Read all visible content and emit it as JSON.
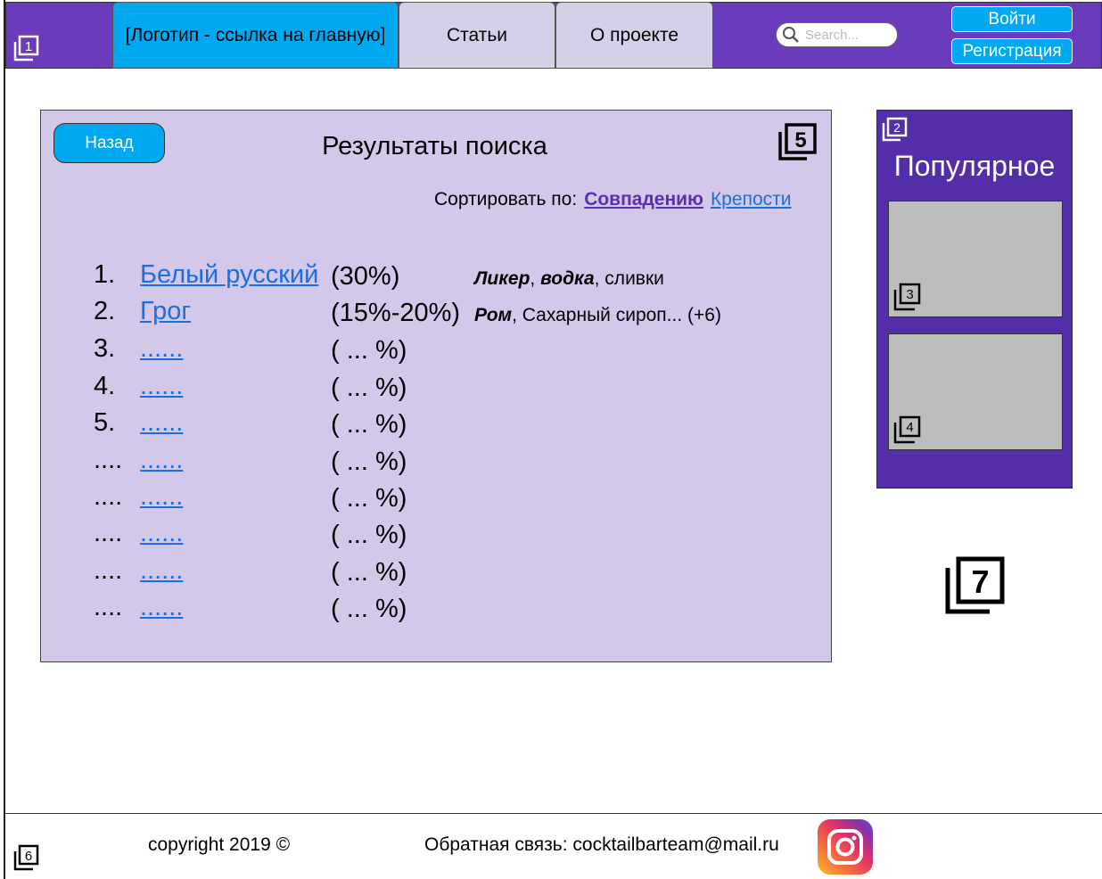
{
  "header": {
    "tabs": [
      {
        "label": "[Логотип - ссылка на главную]"
      },
      {
        "label": "Статьи"
      },
      {
        "label": "О проекте"
      }
    ],
    "search_placeholder": "Search...",
    "login_label": "Войти",
    "register_label": "Регистрация",
    "marker": "1"
  },
  "main": {
    "back_label": "Назад",
    "title": "Результаты поиска",
    "marker": "5",
    "sort": {
      "label": "Сортировать по:",
      "options": [
        "Совпадению",
        "Крепости"
      ],
      "active": "Совпадению"
    },
    "results": [
      {
        "num": "1.",
        "name": "Белый русский",
        "abv": "(30%)",
        "ingredients": [
          {
            "text": "Ликер",
            "bold": true
          },
          {
            "text": ", ",
            "bold": false
          },
          {
            "text": "водка",
            "bold": true
          },
          {
            "text": ", сливки",
            "bold": false
          }
        ]
      },
      {
        "num": "2.",
        "name": "Грог",
        "abv": "(15%-20%)",
        "ingredients": [
          {
            "text": "Ром",
            "bold": true
          },
          {
            "text": ", Сахарный сироп... (+6)",
            "bold": false
          }
        ]
      },
      {
        "num": "3.",
        "name": "......",
        "abv": "( ...  %)"
      },
      {
        "num": "4.",
        "name": "......",
        "abv": "( ...  %)"
      },
      {
        "num": "5.",
        "name": "......",
        "abv": "( ...  %)"
      },
      {
        "num": "....",
        "name": "......",
        "abv": "( ...  %)"
      },
      {
        "num": "....",
        "name": "......",
        "abv": "( ...  %)"
      },
      {
        "num": "....",
        "name": "......",
        "abv": "( ...  %)"
      },
      {
        "num": "....",
        "name": "......",
        "abv": "( ...  %)"
      },
      {
        "num": "....",
        "name": "......",
        "abv": "( ...  %)"
      }
    ]
  },
  "sidebar": {
    "title": "Популярное",
    "marker": "2",
    "cards": [
      {
        "marker": "3"
      },
      {
        "marker": "4"
      }
    ]
  },
  "floating_marker": "7",
  "footer": {
    "copyright": "copyright 2019 ©",
    "feedback": "Обратная связь: cocktailbarteam@mail.ru",
    "marker": "6",
    "social_icon": "instagram-icon"
  }
}
